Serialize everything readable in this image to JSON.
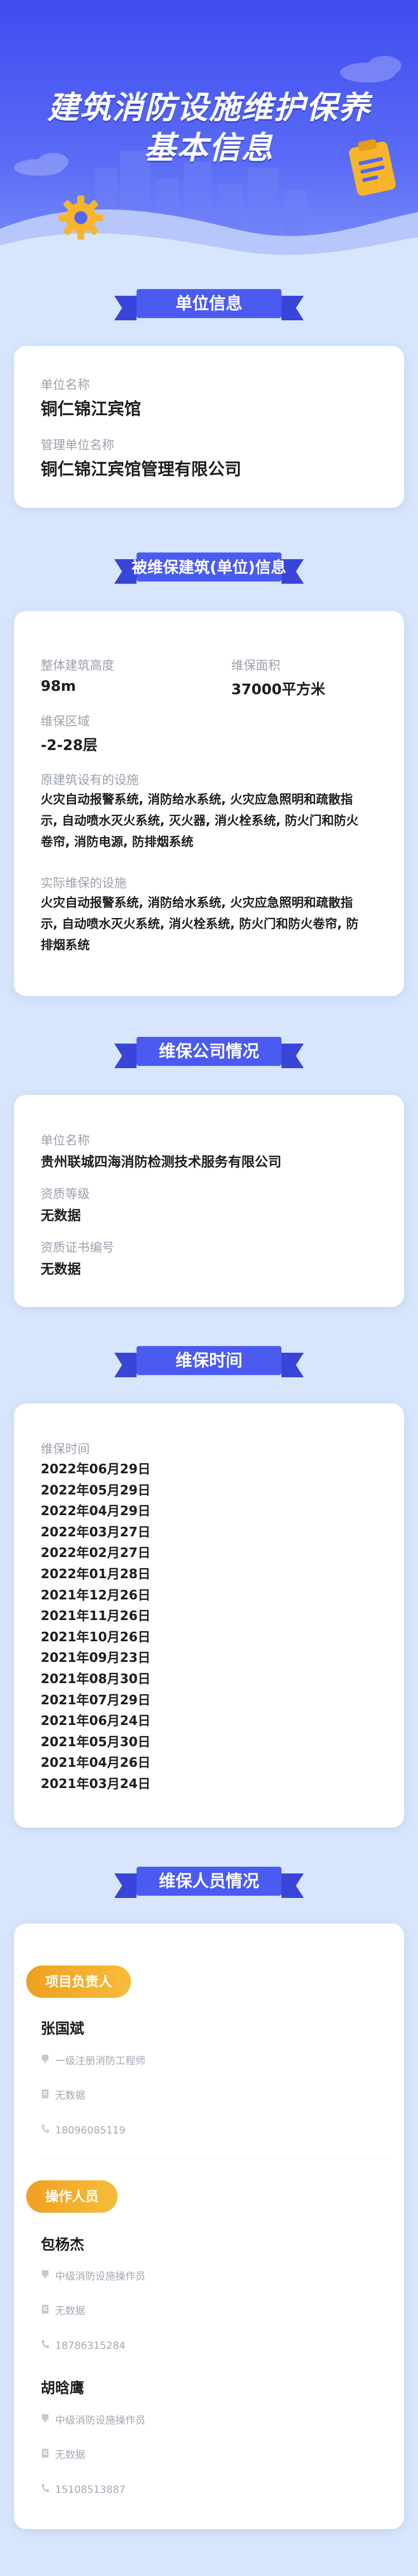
{
  "hero": {
    "title_line1": "建筑消防设施维护保养",
    "title_line2": "基本信息"
  },
  "sections": {
    "unit": "单位信息",
    "building": "被维保建筑(单位)信息",
    "company": "维保公司情况",
    "time": "维保时间",
    "staff": "维保人员情况"
  },
  "unit_info": {
    "unit_name_label": "单位名称",
    "unit_name": "铜仁锦江宾馆",
    "manager_label": "管理单位名称",
    "manager_name": "铜仁锦江宾馆管理有限公司"
  },
  "building_info": {
    "height_label": "整体建筑高度",
    "height": "98m",
    "area_label": "维保面积",
    "area": "37000平方米",
    "region_label": "维保区域",
    "region": "-2-28层",
    "original_label": "原建筑设有的设施",
    "original_line1": "火灾自动报警系统, 消防给水系统, 火灾应急照明和疏散指",
    "original_line2": "示, 自动喷水灭火系统, 灭火器, 消火栓系统, 防火门和防火",
    "original_line3": "卷帘, 消防电源, 防排烟系统",
    "actual_label": "实际维保的设施",
    "actual_line1": "火灾自动报警系统, 消防给水系统, 火灾应急照明和疏散指",
    "actual_line2": "示, 自动喷水灭火系统, 消火栓系统, 防火门和防火卷帘, 防",
    "actual_line3": "排烟系统"
  },
  "company_info": {
    "name_label": "单位名称",
    "name": "贵州联城四海消防检测技术服务有限公司",
    "level_label": "资质等级",
    "level": "无数据",
    "cert_label": "资质证书编号",
    "cert": "无数据"
  },
  "maintenance_time": {
    "label": "维保时间",
    "dates": [
      "2022年06月29日",
      "2022年05月29日",
      "2022年04月29日",
      "2022年03月27日",
      "2022年02月27日",
      "2022年01月28日",
      "2021年12月26日",
      "2021年11月26日",
      "2021年10月26日",
      "2021年09月23日",
      "2021年08月30日",
      "2021年07月29日",
      "2021年06月24日",
      "2021年05月30日",
      "2021年04月26日",
      "2021年03月24日"
    ]
  },
  "staff": {
    "lead_tag": "项目负责人",
    "lead": {
      "name": "张国斌",
      "title": "一级注册消防工程师",
      "cert": "无数据",
      "phone": "18096085119"
    },
    "operator_tag": "操作人员",
    "operators": [
      {
        "name": "包杨杰",
        "title": "中级消防设施操作员",
        "cert": "无数据",
        "phone": "18786315284"
      },
      {
        "name": "胡晗鹰",
        "title": "中级消防设施操作员",
        "cert": "无数据",
        "phone": "15108513887"
      }
    ]
  },
  "icons": {
    "certificate": "certificate-icon",
    "document": "document-icon",
    "phone": "phone-icon",
    "gear": "gear-icon",
    "clipboard": "clipboard-icon"
  },
  "colors": {
    "primary": "#4352ef",
    "page_bg": "#d7e6fc",
    "tag": "#f2a928"
  }
}
